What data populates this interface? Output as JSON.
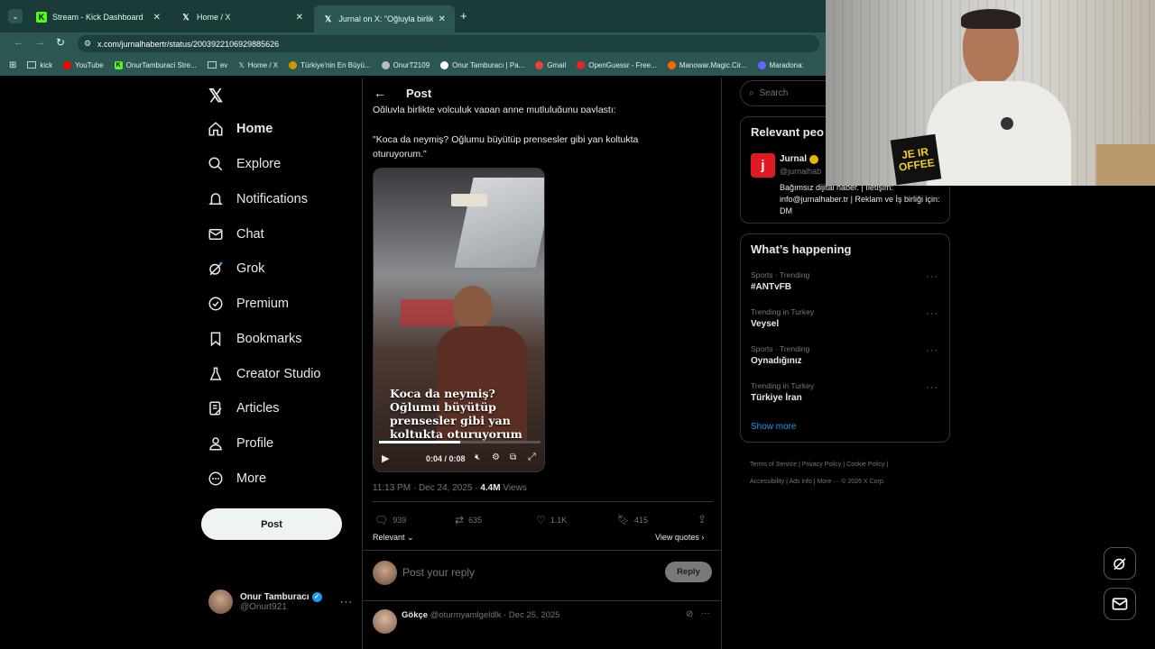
{
  "browser": {
    "tabs": [
      {
        "title": "Stream - Kick Dashboard",
        "icon": "kick-icon"
      },
      {
        "title": "Home / X",
        "icon": "x-icon"
      },
      {
        "title": "Jurnal on X: \"Oğluyla birlikte yo",
        "icon": "x-icon"
      }
    ],
    "url": "x.com/jurnalhabertr/status/2003922106929885626",
    "bookmarks": [
      "kick",
      "YouTube",
      "OnurTamburaci Stre...",
      "ev",
      "Home / X",
      "Türkiye'nin En Büyü...",
      "OnurT2109",
      "Onur Tamburacı | Pa...",
      "Gmail",
      "OpenGuessr - Free...",
      "Manowar.Magic.Cir...",
      "Maradona:"
    ]
  },
  "nav": {
    "items": [
      "Home",
      "Explore",
      "Notifications",
      "Chat",
      "Grok",
      "Premium",
      "Bookmarks",
      "Creator Studio",
      "Articles",
      "Profile",
      "More"
    ],
    "post_label": "Post",
    "user_name": "Onur Tamburacı",
    "user_handle": "@Onurt921"
  },
  "post": {
    "header": "Post",
    "text_cut": "Oğluyla birlikte yolculuk yapan anne mutluluğunu paylaştı:",
    "quote": "\"Koca da neymiş? Oğlumu büyütüp prensesler gibi yan koltukta oturuyorum.\"",
    "video_caption": "Koca da neymiş? Oğlumu büyütüp prensesler gibi yan koltukta oturuyorum",
    "video_time": "0:04 / 0:08",
    "video_progress": 0.5,
    "timestamp": "11:13 PM · Dec 24, 2025 · ",
    "views_count": "4.4M",
    "views_label": " Views",
    "replies": "939",
    "reposts": "635",
    "likes": "1.1K",
    "bookmarks": "415",
    "sort_label": "Relevant",
    "quotes_label": "View quotes",
    "reply_placeholder": "Post your reply",
    "reply_button": "Reply",
    "comment_name": "Gökçe",
    "comment_meta": "@oturmyamlgeldlk · Dec 25, 2025"
  },
  "sidebar": {
    "search_placeholder": "Search",
    "relevant_title": "Relevant peo",
    "account_name": "Jurnal",
    "account_handle": "@jurnalhab",
    "account_bio": "Bağımsız dijital haber. | İletişim: info@jurnalhaber.tr | Reklam ve İş birliği için: DM",
    "happening_title": "What’s happening",
    "trends": [
      {
        "category": "Sports · Trending",
        "name": "#ANTvFB"
      },
      {
        "category": "Trending in Turkey",
        "name": "Veysel"
      },
      {
        "category": "Sports · Trending",
        "name": "Oynadığınız"
      },
      {
        "category": "Trending in Turkey",
        "name": "Türkiye İran"
      }
    ],
    "show_more": "Show more",
    "footer": [
      "Terms of Service",
      "Privacy Policy",
      "Cookie Policy",
      "Accessibility",
      "Ads info",
      "More ···",
      "© 2026 X Corp."
    ]
  },
  "webcam": {
    "shirt_text": "JE IR OFFEE"
  },
  "colors": {
    "accent": "#1d9bf0",
    "kick": "#53fc18",
    "tabbar": "#1b3b38"
  }
}
